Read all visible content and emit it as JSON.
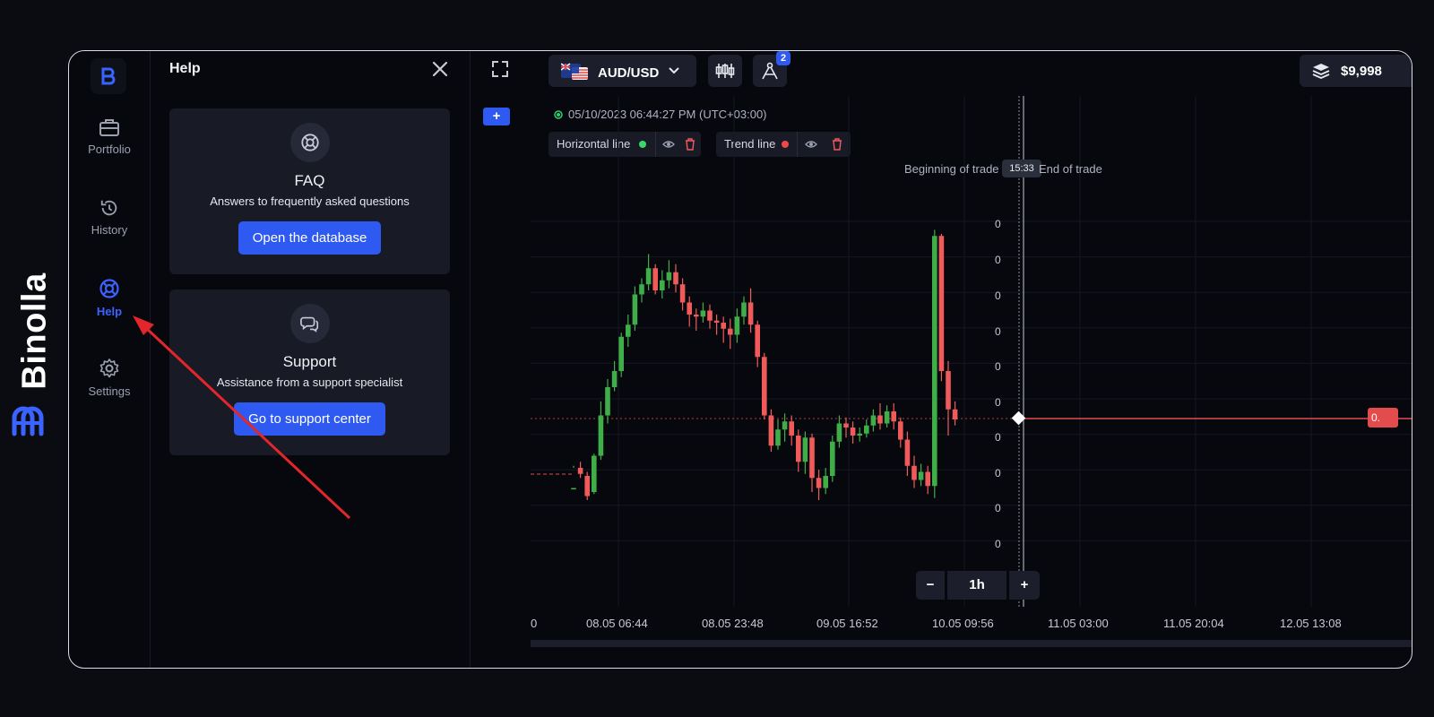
{
  "brand": {
    "name": "Binolla",
    "icon": "binolla-logo-icon"
  },
  "rail": [
    {
      "label": "Portfolio",
      "icon": "briefcase-icon",
      "active": false
    },
    {
      "label": "History",
      "icon": "history-clock-icon",
      "active": false
    },
    {
      "label": "Help",
      "icon": "lifebuoy-icon",
      "active": true
    },
    {
      "label": "Settings",
      "icon": "gear-icon",
      "active": false
    }
  ],
  "help": {
    "title": "Help",
    "close_icon": "close-icon",
    "faq": {
      "title": "FAQ",
      "subtitle": "Answers to frequently asked questions",
      "button": "Open the database",
      "icon": "lifebuoy-icon"
    },
    "support": {
      "title": "Support",
      "subtitle": "Assistance from a support specialist",
      "button": "Go to support center",
      "icon": "chat-bubbles-icon"
    }
  },
  "toolbar": {
    "expand_icon": "expand-icon",
    "add_label": "+",
    "pair": "AUD/USD",
    "pair_flag_icon": "australia-flag-icon",
    "chevron_icon": "chevron-down-icon",
    "indicators_icon": "candlestick-indicators-icon",
    "drawing_icon": "compass-drawing-icon",
    "drawing_badge": "2",
    "balance": "$9,998",
    "balance_icon": "stack-icon"
  },
  "chart_header": {
    "timestamp": "05/10/2023  06:44:27 PM  (UTC+03:00)",
    "live_color": "#2ecc71"
  },
  "drawing_tools": [
    {
      "label": "Horizontal line",
      "dot_color": "#38d86a"
    },
    {
      "label": "Trend line",
      "dot_color": "#f04848"
    }
  ],
  "trade_markers": {
    "beginning": "Beginning of trade",
    "timer": "15:33",
    "end": "End of trade"
  },
  "zoom": {
    "minus": "−",
    "timeframe": "1h",
    "plus": "+"
  },
  "chart_data": {
    "type": "candlestick",
    "x_labels": [
      "0",
      "08.05 06:44",
      "08.05 23:48",
      "09.05 16:52",
      "10.05 09:56",
      "11.05 03:00",
      "11.05 20:04",
      "12.05 13:08"
    ],
    "y_labels": [
      "0",
      "0",
      "0",
      "0",
      "0",
      "0",
      "0",
      "0",
      "0",
      "0"
    ],
    "current_price_label": "0.",
    "colors": {
      "up": "#3fae49",
      "down": "#f05a5a",
      "price_line": "#e24c4c"
    },
    "candles": [
      [
        1.0,
        1.0,
        2.0,
        2.1
      ],
      [
        2.0,
        1.7,
        2.3,
        1.5
      ],
      [
        1.6,
        0.6,
        1.8,
        0.4
      ],
      [
        0.8,
        2.6,
        2.7,
        0.7
      ],
      [
        2.6,
        4.6,
        5.3,
        2.4
      ],
      [
        4.6,
        6.0,
        6.4,
        4.2
      ],
      [
        6.0,
        6.8,
        7.3,
        5.8
      ],
      [
        6.8,
        8.5,
        8.7,
        6.5
      ],
      [
        8.5,
        9.1,
        9.6,
        8.0
      ],
      [
        9.1,
        10.6,
        11.0,
        8.8
      ],
      [
        10.6,
        11.1,
        11.4,
        10.2
      ],
      [
        11.1,
        11.9,
        12.6,
        10.8
      ],
      [
        11.9,
        10.8,
        12.1,
        10.6
      ],
      [
        10.8,
        11.3,
        11.8,
        10.4
      ],
      [
        11.3,
        11.7,
        12.3,
        10.9
      ],
      [
        11.7,
        11.1,
        12.1,
        10.7
      ],
      [
        11.1,
        10.2,
        11.4,
        9.8
      ],
      [
        10.2,
        9.6,
        10.5,
        9.0
      ],
      [
        9.6,
        9.5,
        9.9,
        8.8
      ],
      [
        9.5,
        9.8,
        10.2,
        9.2
      ],
      [
        9.8,
        9.3,
        10.1,
        8.9
      ],
      [
        9.3,
        9.2,
        9.6,
        8.6
      ],
      [
        9.2,
        8.9,
        9.5,
        8.2
      ],
      [
        8.9,
        8.6,
        9.4,
        7.9
      ],
      [
        8.6,
        9.5,
        9.9,
        8.2
      ],
      [
        9.5,
        10.2,
        10.5,
        9.1
      ],
      [
        10.2,
        9.1,
        10.9,
        8.7
      ],
      [
        9.1,
        7.5,
        9.3,
        7.0
      ],
      [
        7.5,
        4.6,
        7.7,
        4.4
      ],
      [
        4.6,
        3.1,
        4.9,
        2.8
      ],
      [
        3.1,
        3.9,
        4.4,
        2.9
      ],
      [
        3.9,
        4.3,
        4.7,
        3.3
      ],
      [
        4.3,
        3.6,
        4.6,
        3.1
      ],
      [
        3.6,
        2.3,
        3.9,
        1.8
      ],
      [
        2.3,
        3.5,
        3.8,
        1.7
      ],
      [
        3.5,
        1.5,
        3.7,
        0.8
      ],
      [
        1.5,
        1.0,
        1.9,
        0.4
      ],
      [
        1.0,
        1.6,
        2.0,
        0.7
      ],
      [
        1.6,
        3.3,
        3.6,
        1.3
      ],
      [
        3.3,
        4.2,
        4.6,
        3.0
      ],
      [
        4.2,
        4.0,
        4.5,
        3.5
      ],
      [
        4.0,
        3.6,
        4.3,
        3.2
      ],
      [
        3.6,
        3.7,
        4.0,
        3.3
      ],
      [
        3.7,
        4.1,
        4.4,
        3.5
      ],
      [
        4.1,
        4.6,
        4.9,
        3.8
      ],
      [
        4.6,
        4.2,
        5.2,
        3.9
      ],
      [
        4.2,
        4.8,
        5.1,
        4.0
      ],
      [
        4.8,
        4.3,
        5.2,
        3.9
      ],
      [
        4.3,
        3.4,
        4.5,
        3.0
      ],
      [
        3.4,
        2.1,
        3.8,
        1.6
      ],
      [
        2.1,
        1.4,
        2.6,
        1.0
      ],
      [
        1.4,
        1.8,
        2.2,
        1.1
      ],
      [
        1.8,
        1.1,
        2.1,
        0.7
      ],
      [
        1.1,
        13.5,
        13.8,
        0.5
      ],
      [
        13.5,
        6.8,
        13.6,
        6.3
      ],
      [
        6.8,
        4.9,
        7.3,
        3.6
      ],
      [
        4.9,
        4.4,
        5.3,
        4.1
      ]
    ]
  }
}
